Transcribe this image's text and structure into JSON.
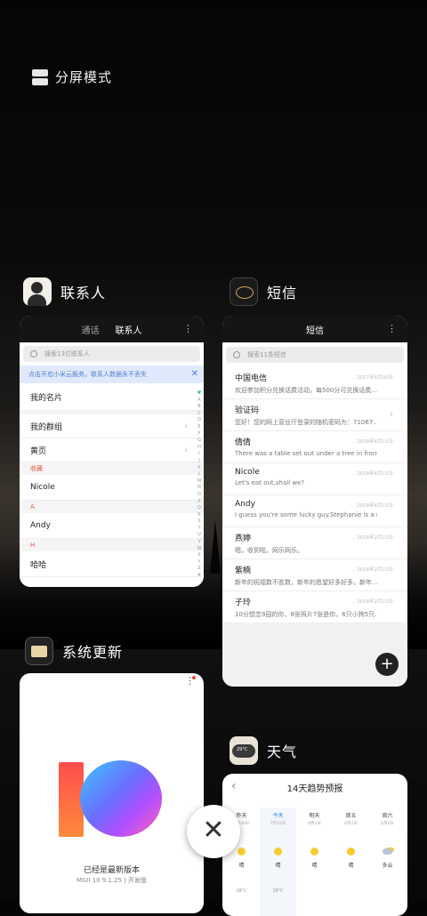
{
  "split_screen": {
    "label": "分屏模式"
  },
  "apps": {
    "contacts": {
      "title": "联系人",
      "tabs": [
        "通话",
        "联系人"
      ],
      "menu": "⋮",
      "search_placeholder": "搜索13位联系人",
      "notice": "点击开启小米云服务，联系人数据永不丢失",
      "notice_close": "✕",
      "rows": {
        "my_card": "我的名片",
        "my_groups": "我的群组",
        "yellow_pages": "黄页"
      },
      "sections": {
        "favorites": "收藏",
        "a": "A",
        "h": "H"
      },
      "contacts": {
        "nicole": "Nicole",
        "andy": "Andy",
        "haha": "哈哈"
      },
      "alphabet": [
        "♥",
        "A",
        "B",
        "C",
        "D",
        "E",
        "F",
        "G",
        "H",
        "I",
        "J",
        "K",
        "L",
        "M",
        "N",
        "O",
        "P",
        "Q",
        "R",
        "S",
        "T",
        "U",
        "V",
        "W",
        "X",
        "Y",
        "Z",
        "#"
      ]
    },
    "messages": {
      "title": "短信",
      "header": "短信",
      "menu": "⋮",
      "search_placeholder": "搜索11条短信",
      "fab": "+",
      "items": [
        {
          "name": "中国电信",
          "preview": "欢迎参加积分兑换话费活动，每500分可兑换话费...",
          "date": "2017年8月30日"
        },
        {
          "name": "验证码",
          "preview": "您好！您的网上营业厅登录的随机密码为：71067...",
          "date": ""
        },
        {
          "name": "倩倩",
          "preview": "There was a table set out under a tree in front o...",
          "date": "2018年6月13日"
        },
        {
          "name": "Nicole",
          "preview": "Let's eat out,shall we?",
          "date": "2018年6月13日"
        },
        {
          "name": "Andy",
          "preview": "I guess you're some lucky guy.Stephanie is a n...",
          "date": "2018年6月13日"
        },
        {
          "name": "燕婷",
          "preview": "嗯。收到啦。网乐网乐。",
          "date": "2018年2月22日"
        },
        {
          "name": "紫楠",
          "preview": "新年的祝福数不胜数，新年的愿望好多好多，新年...",
          "date": "2018年2月22日"
        },
        {
          "name": "子玲",
          "preview": "10分想念9园的你，8张照片7张是你，6只小狗5只...",
          "date": "2018年2月22日"
        }
      ]
    },
    "updater": {
      "title": "系统更新",
      "menu": "⋮",
      "status": "已经是最新版本",
      "version": "MIUI 10 9.1.25 | 开发版"
    },
    "weather": {
      "title": "天气",
      "icon_temp": "29°C",
      "back": "‹",
      "header": "14天趋势预报",
      "days": [
        {
          "label": "昨天",
          "date": "7月30日"
        },
        {
          "label": "今天",
          "date": "7月31日"
        },
        {
          "label": "明天",
          "date": "8月1日"
        },
        {
          "label": "周五",
          "date": "8月2日"
        },
        {
          "label": "周六",
          "date": "8月3日"
        }
      ],
      "conditions": [
        "晴",
        "晴",
        "晴",
        "晴",
        "多云"
      ],
      "temps": [
        "38°C",
        "38°C"
      ]
    }
  },
  "close_button": "✕"
}
